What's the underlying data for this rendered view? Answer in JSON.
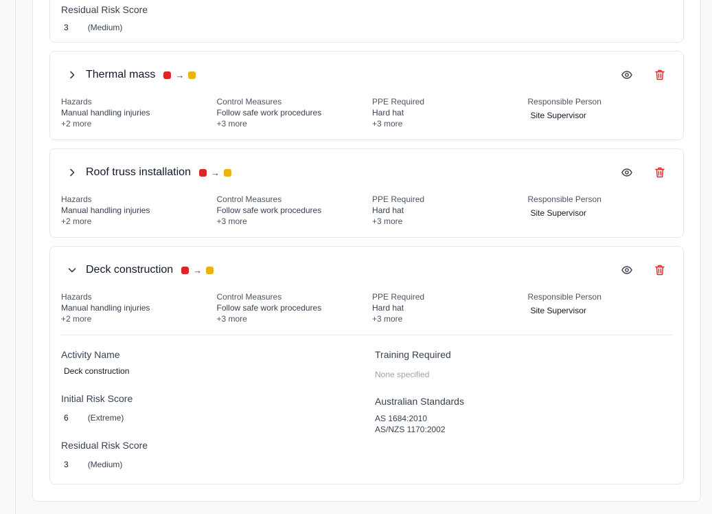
{
  "top_card": {
    "residual_label": "Residual Risk Score",
    "residual_score": "3",
    "residual_level": "(Medium)"
  },
  "colors": {
    "initial": "#dc2626",
    "residual": "#eab308"
  },
  "activities": [
    {
      "title": "Thermal mass",
      "hazards_label": "Hazards",
      "hazards_first": "Manual handling injuries",
      "hazards_more": "+2 more",
      "controls_label": "Control Measures",
      "controls_first": "Follow safe work procedures",
      "controls_more": "+3 more",
      "ppe_label": "PPE Required",
      "ppe_first": "Hard hat",
      "ppe_more": "+3 more",
      "resp_label": "Responsible Person",
      "resp_value": "Site Supervisor"
    },
    {
      "title": "Roof truss installation",
      "hazards_label": "Hazards",
      "hazards_first": "Manual handling injuries",
      "hazards_more": "+2 more",
      "controls_label": "Control Measures",
      "controls_first": "Follow safe work procedures",
      "controls_more": "+3 more",
      "ppe_label": "PPE Required",
      "ppe_first": "Hard hat",
      "ppe_more": "+3 more",
      "resp_label": "Responsible Person",
      "resp_value": "Site Supervisor"
    },
    {
      "title": "Deck construction",
      "hazards_label": "Hazards",
      "hazards_first": "Manual handling injuries",
      "hazards_more": "+2 more",
      "controls_label": "Control Measures",
      "controls_first": "Follow safe work procedures",
      "controls_more": "+3 more",
      "ppe_label": "PPE Required",
      "ppe_first": "Hard hat",
      "ppe_more": "+3 more",
      "resp_label": "Responsible Person",
      "resp_value": "Site Supervisor"
    }
  ],
  "details": {
    "activity_name_label": "Activity Name",
    "activity_name_value": "Deck construction",
    "initial_label": "Initial Risk Score",
    "initial_score": "6",
    "initial_level": "(Extreme)",
    "residual_label": "Residual Risk Score",
    "residual_score": "3",
    "residual_level": "(Medium)",
    "training_label": "Training Required",
    "training_value": "None specified",
    "standards_label": "Australian Standards",
    "standards": [
      "AS 1684:2010",
      "AS/NZS 1170:2002"
    ]
  },
  "icons": {
    "view": "eye-icon",
    "delete": "trash-icon",
    "collapsed": "chevron-right-icon",
    "expanded": "chevron-down-icon"
  }
}
